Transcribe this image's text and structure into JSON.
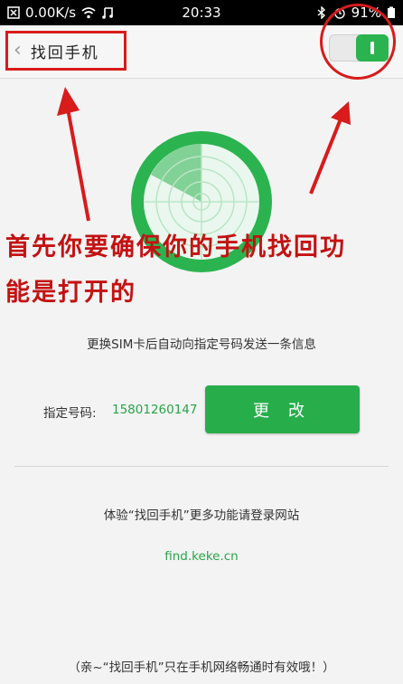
{
  "statusbar": {
    "net_speed": "0.00K/s",
    "time": "20:33",
    "battery": "91%"
  },
  "appbar": {
    "title": "找回手机"
  },
  "annotation": {
    "line1": "首先你要确保你的手机找回功",
    "line2": "能是打开的"
  },
  "main": {
    "sim_notice": "更换SIM卡后自动向指定号码发送一条信息",
    "phone_label": "指定号码:",
    "phone_number": "15801260147",
    "change_button": "更 改",
    "experience_text": "体验“找回手机”更多功能请登录网站",
    "website": "find.keke.cn",
    "footer_note": "（亲~“找回手机”只在手机网络畅通时有效哦！）"
  },
  "colors": {
    "accent_green": "#27ae4b",
    "annotation_red": "#d81b1b"
  },
  "icons": [
    "close-box-icon",
    "wifi-icon",
    "music-icon",
    "bluetooth-icon",
    "alarm-icon",
    "battery-icon",
    "back-chevron-icon",
    "radar-icon",
    "arrow-icon"
  ]
}
